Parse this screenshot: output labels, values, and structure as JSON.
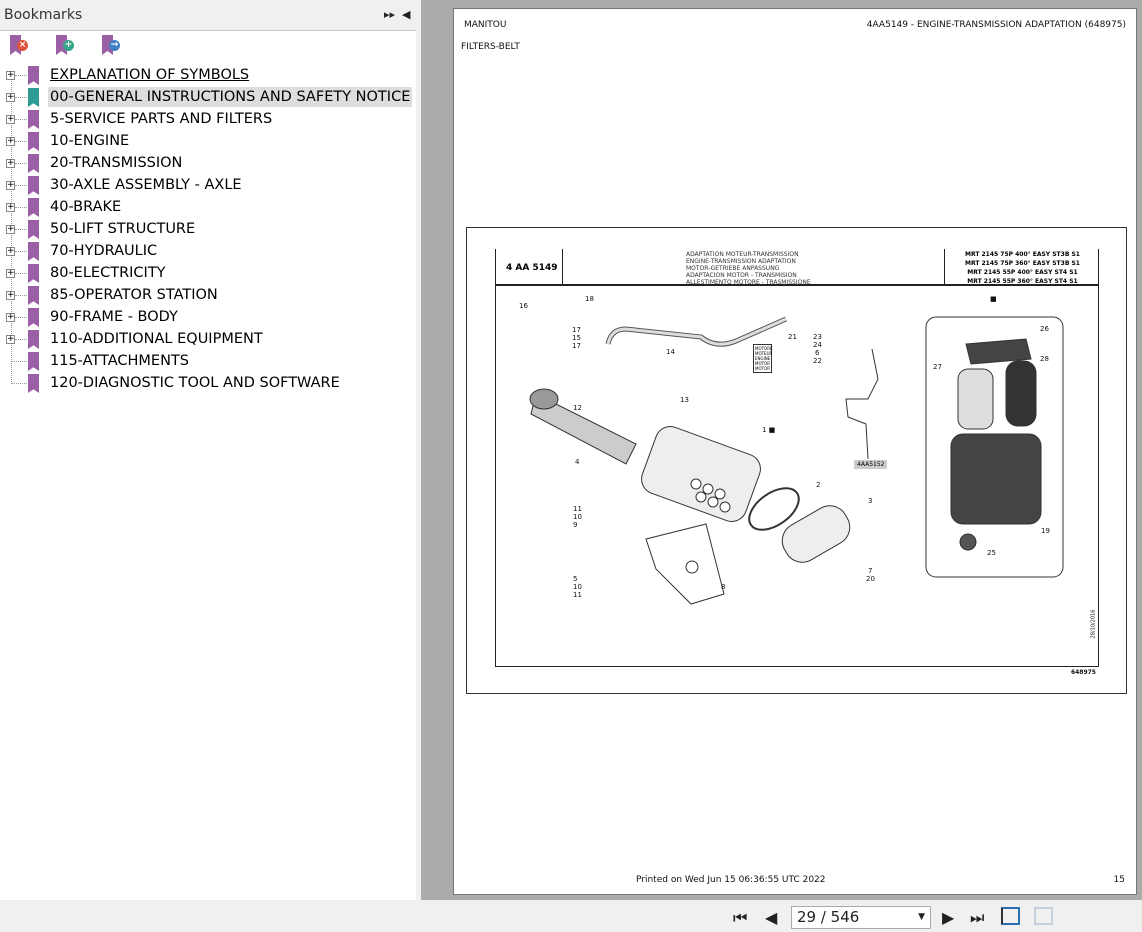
{
  "sidebar": {
    "title": "Bookmarks",
    "collapse_icon": "double-arrow-right",
    "close_icon": "triangle-left",
    "tools": [
      "remove-bookmark",
      "add-bookmark",
      "goto-bookmark"
    ],
    "items": [
      {
        "label": "EXPLANATION OF SYMBOLS",
        "expandable": true
      },
      {
        "label": "00-GENERAL INSTRUCTIONS AND SAFETY NOTICE",
        "expandable": true,
        "selected": true
      },
      {
        "label": "5-SERVICE PARTS AND FILTERS",
        "expandable": true
      },
      {
        "label": "10-ENGINE",
        "expandable": true
      },
      {
        "label": "20-TRANSMISSION",
        "expandable": true
      },
      {
        "label": "30-AXLE ASSEMBLY - AXLE",
        "expandable": true
      },
      {
        "label": "40-BRAKE",
        "expandable": true
      },
      {
        "label": "50-LIFT STRUCTURE",
        "expandable": true
      },
      {
        "label": "70-HYDRAULIC",
        "expandable": true
      },
      {
        "label": "80-ELECTRICITY",
        "expandable": true
      },
      {
        "label": "85-OPERATOR STATION",
        "expandable": true
      },
      {
        "label": "90-FRAME - BODY",
        "expandable": true
      },
      {
        "label": "110-ADDITIONAL EQUIPMENT",
        "expandable": true
      },
      {
        "label": "115-ATTACHMENTS",
        "expandable": false
      },
      {
        "label": "120-DIAGNOSTIC TOOL AND SOFTWARE",
        "expandable": false
      }
    ]
  },
  "page": {
    "brand": "MANITOU",
    "header_right": "4AA5149 - ENGINE-TRANSMISSION ADAPTATION (648975)",
    "subtitle": "FILTERS-BELT",
    "printed": "Printed on  Wed Jun 15 06:36:55 UTC 2022",
    "page_number": "15",
    "drawing": {
      "code": "4 AA 5149",
      "titles": [
        "ADAPTATION MOTEUR-TRANSMISSION",
        "ENGINE-TRANSMISSION ADAPTATION",
        "MOTOR-GETRIEBE ANPASSUNG",
        "ADAPTACION MOTOR - TRANSMISION",
        "ALLESTIMENTO MOTORE - TRASMISSIONE"
      ],
      "models": [
        "MRT 2145 75P 400° EASY ST3B S1",
        "MRT 2145 75P 360° EASY ST3B S1",
        "MRT 2145 55P 400° EASY ST4 S1",
        "MRT 2145 55P 360° EASY ST4 S1"
      ],
      "ref": "648975",
      "date": "28/10/2016",
      "link": "4AA5152",
      "motor_labels": [
        "MOTORE",
        "MOTEUR",
        "ENGINE",
        "MOTOR",
        "MOTOR"
      ],
      "callouts": [
        "18",
        "16",
        "17",
        "15",
        "17",
        "14",
        "12",
        "13",
        "21",
        "23",
        "24",
        "6",
        "22",
        "1 ■",
        "4",
        "2",
        "3",
        "11",
        "10",
        "9",
        "5",
        "10",
        "11",
        "8",
        "7",
        "20",
        "■",
        "26",
        "27",
        "28",
        "25",
        "19"
      ]
    }
  },
  "nav": {
    "current_page": "29",
    "total_pages": "546",
    "page_display": "29 / 546"
  }
}
